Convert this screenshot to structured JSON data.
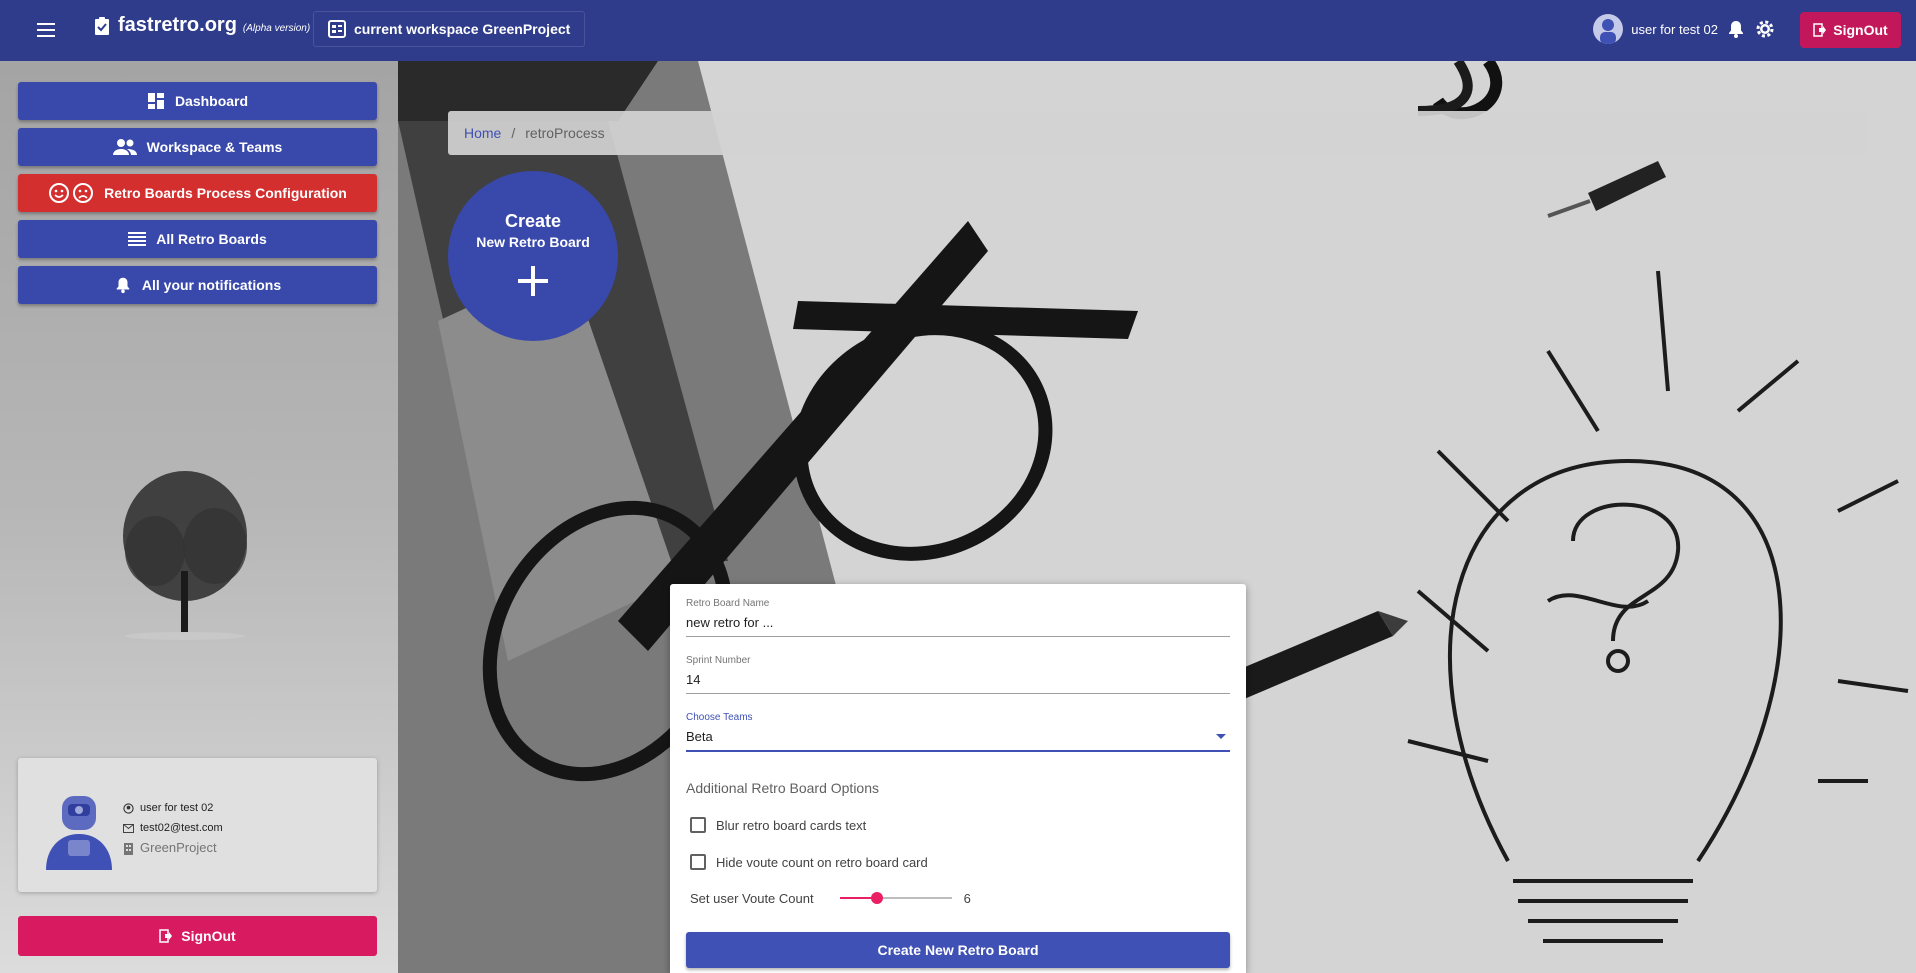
{
  "topbar": {
    "brand": "fastretro.org",
    "brand_sub": "(Alpha version)",
    "workspace": "current workspace GreenProject",
    "user_name": "user for test 02",
    "signout": "SignOut"
  },
  "sidebar": {
    "items": [
      {
        "label": "Dashboard",
        "icon": "dashboard-icon"
      },
      {
        "label": "Workspace & Teams",
        "icon": "people-icon"
      },
      {
        "label": "Retro Boards Process Configuration",
        "icon": "smile-frown-icon",
        "active": true
      },
      {
        "label": "All Retro Boards",
        "icon": "list-icon"
      },
      {
        "label": "All your notifications",
        "icon": "bell-icon"
      }
    ],
    "profile": {
      "name": "user for test 02",
      "email": "test02@test.com",
      "workspace": "GreenProject"
    },
    "signout": "SignOut"
  },
  "breadcrumb": {
    "home": "Home",
    "separator": "/",
    "current": "retroProcess"
  },
  "create_fab": {
    "line1": "Create",
    "line2": "New Retro Board"
  },
  "form": {
    "name_label": "Retro Board Name",
    "name_value": "new retro for ...",
    "sprint_label": "Sprint Number",
    "sprint_value": "14",
    "teams_label": "Choose Teams",
    "teams_value": "Beta",
    "options_title": "Additional Retro Board Options",
    "blur_label": "Blur retro board cards text",
    "blur_checked": false,
    "hide_label": "Hide voute count on retro board card",
    "hide_checked": false,
    "vote_label": "Set user Voute Count",
    "vote_value": "6",
    "vote_fraction": 0.33,
    "submit": "Create New Retro Board"
  },
  "colors": {
    "topbar": "#2f3c8b",
    "primary": "#3949ab",
    "active": "#d32f2f",
    "signout": "#d81b60",
    "slider": "#e91e63"
  }
}
